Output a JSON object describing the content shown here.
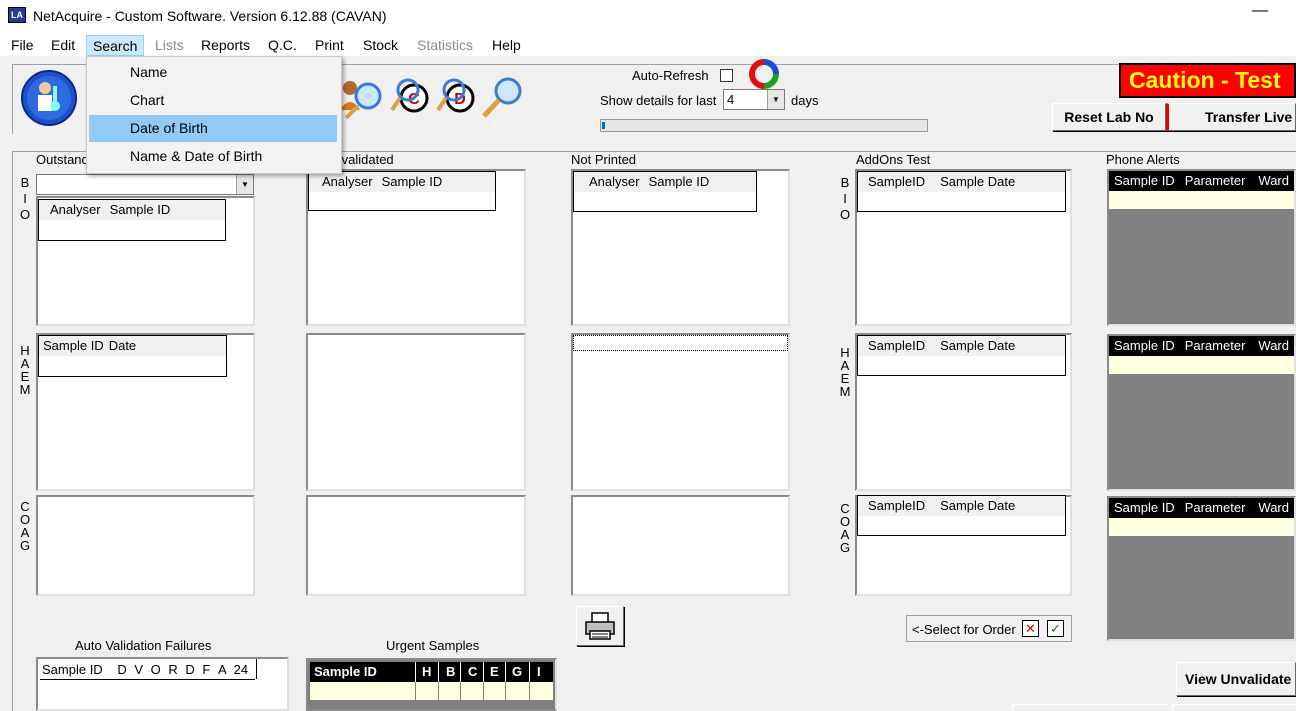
{
  "window": {
    "title": "NetAcquire - Custom Software. Version 6.12.88 (CAVAN)",
    "icon_text": "LA",
    "minimize_glyph": "—"
  },
  "menubar": [
    {
      "label": "File",
      "state": "normal"
    },
    {
      "label": "Edit",
      "state": "normal"
    },
    {
      "label": "Search",
      "state": "active"
    },
    {
      "label": "Lists",
      "state": "disabled"
    },
    {
      "label": "Reports",
      "state": "normal"
    },
    {
      "label": "Q.C.",
      "state": "normal"
    },
    {
      "label": "Print",
      "state": "normal"
    },
    {
      "label": "Stock",
      "state": "normal"
    },
    {
      "label": "Statistics",
      "state": "disabled"
    },
    {
      "label": "Help",
      "state": "normal"
    }
  ],
  "search_menu": {
    "items": [
      "Name",
      "Chart",
      "Date of Birth",
      "Name & Date of Birth"
    ],
    "highlighted": "Date of Birth"
  },
  "toolbar": {
    "auto_refresh_label": "Auto-Refresh",
    "auto_refresh_checked": false,
    "show_details_label": "Show details for last",
    "days_value": "4",
    "days_label": "days",
    "progress_fraction": 0.01,
    "icons": [
      "person-search-icon",
      "search-c-icon",
      "search-d-icon",
      "magnifier-icon"
    ]
  },
  "caution_banner": "Caution - Test",
  "buttons": {
    "reset_lab_no": "Reset Lab No",
    "transfer_live": "Transfer Live",
    "view_unvalidated": "View Unvalidate"
  },
  "columns": {
    "outstanding": "Outstanding",
    "unvalidated": "Unvalidated",
    "not_printed": "Not Printed",
    "addons": "AddOns Test",
    "phone_alerts": "Phone Alerts"
  },
  "section_labels": {
    "bio": [
      "B",
      "I",
      "O"
    ],
    "haem": [
      "H",
      "A",
      "E",
      "M"
    ],
    "coag": [
      "C",
      "O",
      "A",
      "G"
    ]
  },
  "grid_headers": {
    "analyser": "Analyser",
    "sample_id": "Sample ID",
    "date": "Date",
    "sampleid": "SampleID",
    "sample_date": "Sample Date",
    "parameter": "Parameter",
    "ward": "Ward"
  },
  "auto_validation": {
    "title": "Auto Validation Failures",
    "headers": [
      "Sample ID",
      "D",
      "V",
      "O",
      "R",
      "D",
      "F",
      "A",
      "24"
    ]
  },
  "urgent_samples": {
    "title": "Urgent Samples",
    "headers": [
      "Sample ID",
      "H",
      "B",
      "C",
      "E",
      "G",
      "I"
    ]
  },
  "select_for_order": "<-Select for Order"
}
